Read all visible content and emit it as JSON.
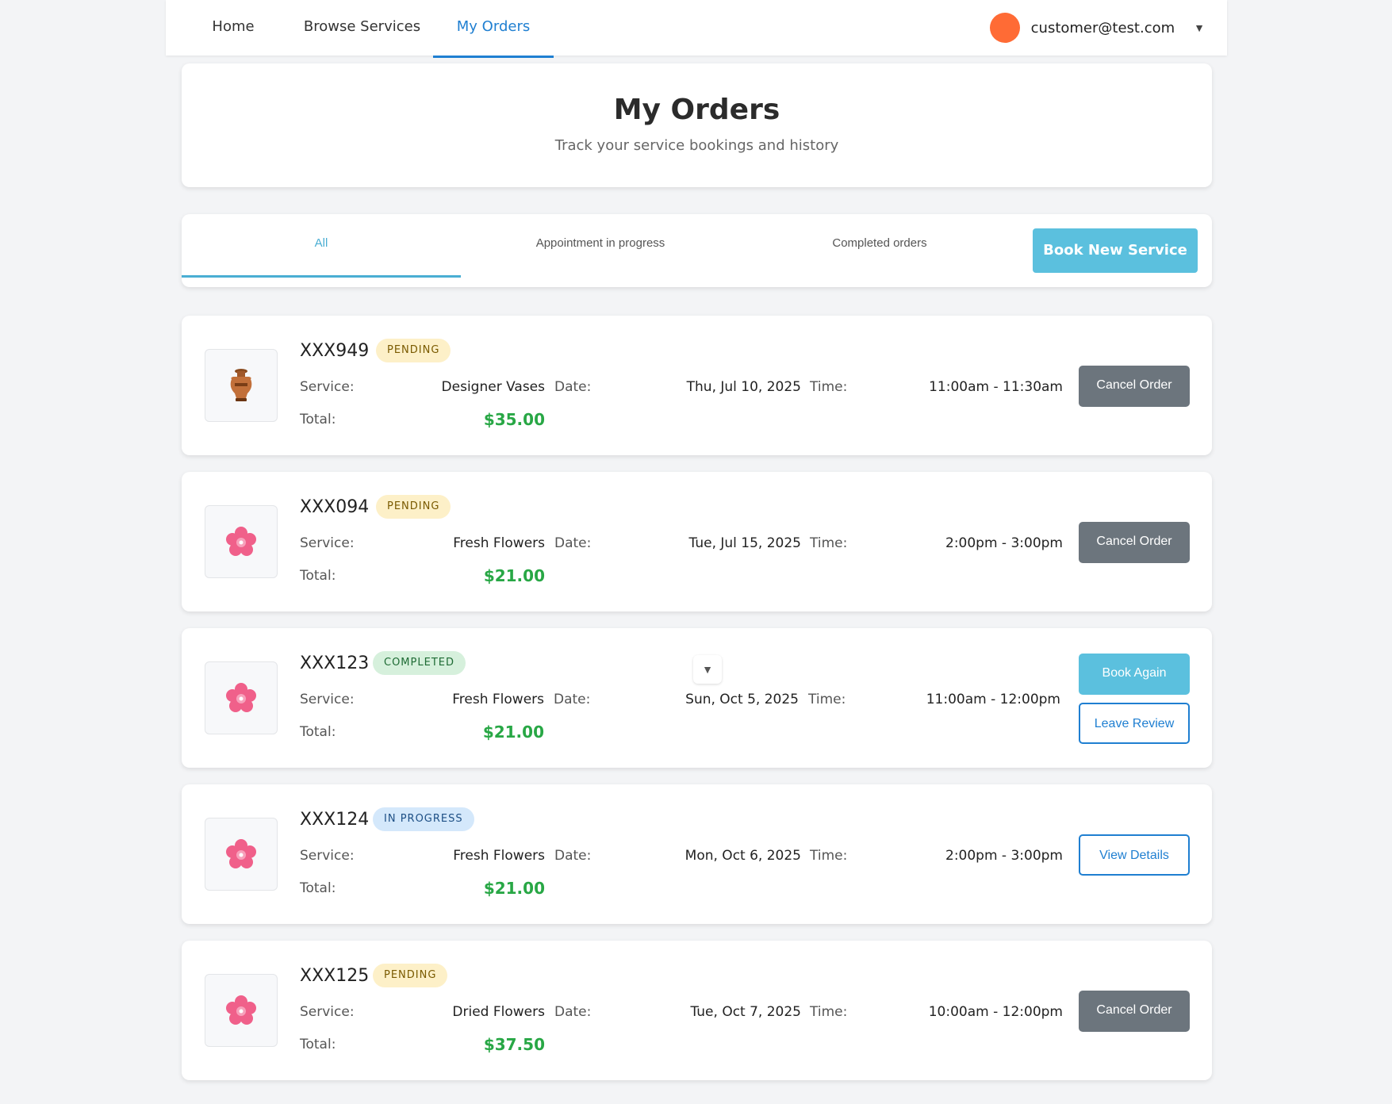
{
  "nav": {
    "home": "Home",
    "browse": "Browse Services",
    "orders": "My Orders",
    "user_email": "customer@test.com"
  },
  "header": {
    "title": "My Orders",
    "subtitle": "Track your service bookings and history"
  },
  "tabs": {
    "all": "All",
    "progress": "Appointment in progress",
    "completed": "Completed orders",
    "book_new": "Book New Service"
  },
  "labels": {
    "service": "Service:",
    "date": "Date:",
    "time": "Time:",
    "total": "Total:"
  },
  "orders": [
    {
      "id": "XXX949",
      "status": "PENDING",
      "service": "Designer Vases",
      "date": "Thu, Jul 10, 2025",
      "time": "11:00am - 11:30am",
      "total": "$35.00",
      "action": "Cancel Order",
      "icon": "vase-icon"
    },
    {
      "id": "XXX094",
      "status": "PENDING",
      "service": "Fresh Flowers",
      "date": "Tue, Jul 15, 2025",
      "time": "2:00pm - 3:00pm",
      "total": "$21.00",
      "action": "Cancel Order",
      "icon": "flower-icon"
    },
    {
      "id": "XXX123",
      "status": "COMPLETED",
      "service": "Fresh Flowers",
      "date": "Sun, Oct 5, 2025",
      "time": "11:00am - 12:00pm",
      "total": "$21.00",
      "action": "Book Again",
      "action2": "Leave Review",
      "icon": "flower-icon"
    },
    {
      "id": "XXX124",
      "status": "IN PROGRESS",
      "service": "Fresh Flowers",
      "date": "Mon, Oct 6, 2025",
      "time": "2:00pm - 3:00pm",
      "total": "$21.00",
      "action": "View Details",
      "icon": "flower-icon"
    },
    {
      "id": "XXX125",
      "status": "PENDING",
      "service": "Dried Flowers",
      "date": "Tue, Oct 7, 2025",
      "time": "10:00am - 12:00pm",
      "total": "$37.50",
      "action": "Cancel Order",
      "icon": "flower-icon"
    }
  ],
  "colors": {
    "accent": "#1f7fd1",
    "tab_accent": "#5bc0de",
    "price": "#28a745",
    "avatar": "#ff6b35"
  }
}
